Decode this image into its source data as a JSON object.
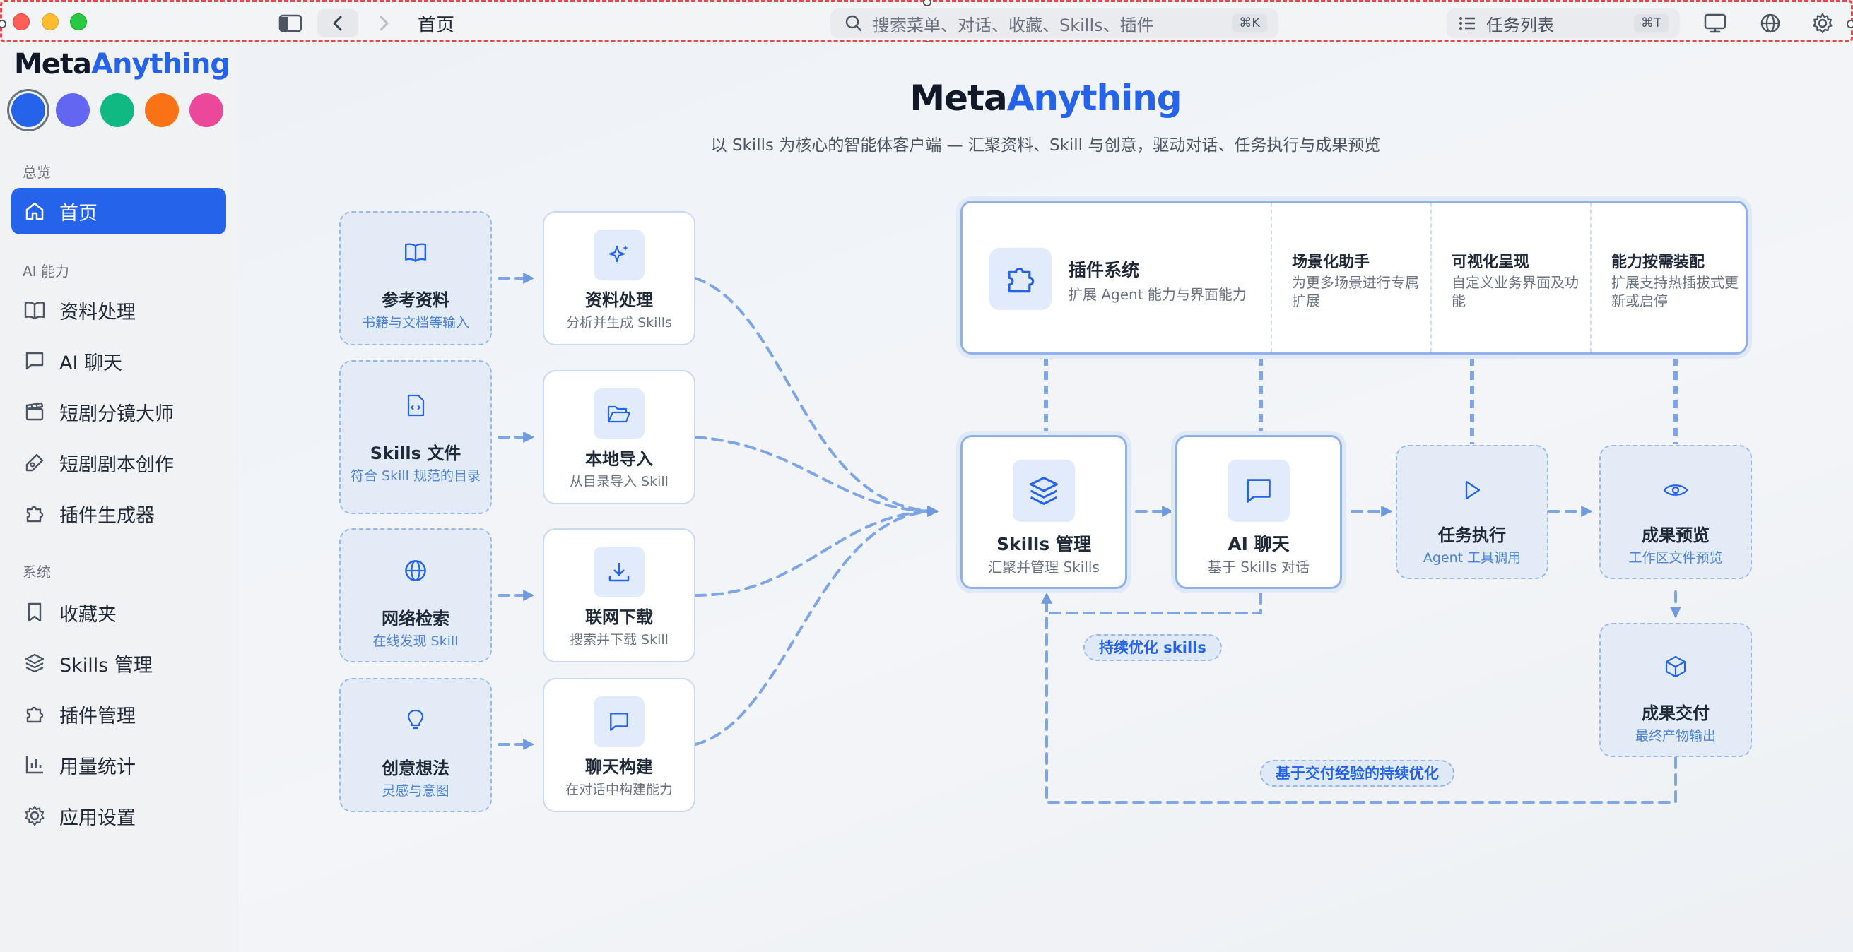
{
  "titlebar": {
    "page_title": "首页",
    "search_placeholder": "搜索菜单、对话、收藏、Skills、插件",
    "search_shortcut": "⌘K",
    "tasks_label": "任务列表",
    "tasks_shortcut": "⌘T"
  },
  "sidebar": {
    "brand": {
      "part1": "Meta",
      "part2": "Anything"
    },
    "theme_colors": [
      "#2563eb",
      "#6366f1",
      "#10b981",
      "#f97316",
      "#ec4899"
    ],
    "sections": {
      "overview": "总览",
      "ai": "AI 能力",
      "system": "系统"
    },
    "items": [
      {
        "label": "首页",
        "icon": "home-icon"
      },
      {
        "label": "资料处理",
        "icon": "book-icon"
      },
      {
        "label": "AI 聊天",
        "icon": "chat-icon"
      },
      {
        "label": "短剧分镜大师",
        "icon": "clapperboard-icon"
      },
      {
        "label": "短剧剧本创作",
        "icon": "pen-icon"
      },
      {
        "label": "插件生成器",
        "icon": "puzzle-icon"
      },
      {
        "label": "收藏夹",
        "icon": "bookmark-icon"
      },
      {
        "label": "Skills 管理",
        "icon": "layers-icon"
      },
      {
        "label": "插件管理",
        "icon": "puzzle-icon"
      },
      {
        "label": "用量统计",
        "icon": "bar-chart-icon"
      },
      {
        "label": "应用设置",
        "icon": "gear-icon"
      }
    ]
  },
  "main": {
    "title": {
      "part1": "Meta",
      "part2": "Anything"
    },
    "subtitle": "以 Skills 为核心的智能体客户端 — 汇聚资料、Skill 与创意，驱动对话、任务执行与成果预览",
    "sources": [
      {
        "title": "参考资料",
        "sub": "书籍与文档等输入",
        "icon": "book-icon"
      },
      {
        "title": "Skills 文件",
        "sub": "符合 Skill 规范的目录",
        "icon": "code-file-icon"
      },
      {
        "title": "网络检索",
        "sub": "在线发现 Skill",
        "icon": "globe-icon"
      },
      {
        "title": "创意想法",
        "sub": "灵感与意图",
        "icon": "lightbulb-icon"
      }
    ],
    "processors": [
      {
        "title": "资料处理",
        "sub": "分析并生成 Skills",
        "icon": "sparkles-icon"
      },
      {
        "title": "本地导入",
        "sub": "从目录导入 Skill",
        "icon": "folder-open-icon"
      },
      {
        "title": "联网下载",
        "sub": "搜索并下载 Skill",
        "icon": "download-icon"
      },
      {
        "title": "聊天构建",
        "sub": "在对话中构建能力",
        "icon": "chat-icon"
      }
    ],
    "plugin_system": {
      "title": "插件系统",
      "sub": "扩展 Agent 能力与界面能力",
      "features": [
        {
          "title": "场景化助手",
          "sub": "为更多场景进行专属扩展"
        },
        {
          "title": "可视化呈现",
          "sub": "自定义业务界面及功能"
        },
        {
          "title": "能力按需装配",
          "sub": "扩展支持热插拔式更新或启停"
        }
      ]
    },
    "skills_mgmt": {
      "title": "Skills 管理",
      "sub": "汇聚并管理 Skills"
    },
    "ai_chat": {
      "title": "AI 聊天",
      "sub": "基于 Skills 对话"
    },
    "task_exec": {
      "title": "任务执行",
      "sub": "Agent 工具调用"
    },
    "preview": {
      "title": "成果预览",
      "sub": "工作区文件预览"
    },
    "delivery": {
      "title": "成果交付",
      "sub": "最终产物输出"
    },
    "loop_labels": {
      "inner": "持续优化 skills",
      "outer": "基于交付经验的持续优化"
    }
  }
}
